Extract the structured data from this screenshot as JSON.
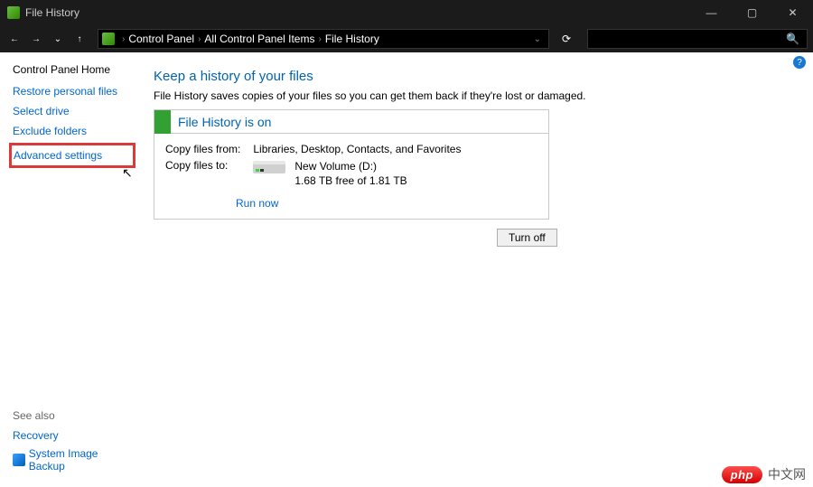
{
  "window": {
    "title": "File History"
  },
  "titlebar_controls": {
    "minimize": "—",
    "maximize": "▢",
    "close": "✕"
  },
  "nav": {
    "back": "←",
    "forward": "→",
    "dropdown": "⌄",
    "up": "↑",
    "refresh": "⟳",
    "addr_dropdown": "⌄"
  },
  "breadcrumb": {
    "items": [
      {
        "label": "Control Panel"
      },
      {
        "label": "All Control Panel Items"
      },
      {
        "label": "File History"
      }
    ],
    "separator": "›"
  },
  "search": {
    "placeholder": "",
    "icon": "🔍"
  },
  "sidebar": {
    "home": "Control Panel Home",
    "links": [
      "Restore personal files",
      "Select drive",
      "Exclude folders",
      "Advanced settings"
    ],
    "see_also_heading": "See also",
    "see_also_links": [
      "Recovery",
      "System Image Backup"
    ]
  },
  "main": {
    "help_icon": "?",
    "heading": "Keep a history of your files",
    "description": "File History saves copies of your files so you can get them back if they're lost or damaged.",
    "status_bar": "File History is on",
    "details": {
      "label_from": "Copy files from:",
      "value_from": "Libraries, Desktop, Contacts, and Favorites",
      "label_to": "Copy files to:",
      "drive_name": "New Volume (D:)",
      "drive_space": "1.68 TB free of 1.81 TB"
    },
    "run_now": "Run now",
    "action_button": "Turn off"
  },
  "watermark": {
    "badge": "php",
    "text": "中文网"
  }
}
